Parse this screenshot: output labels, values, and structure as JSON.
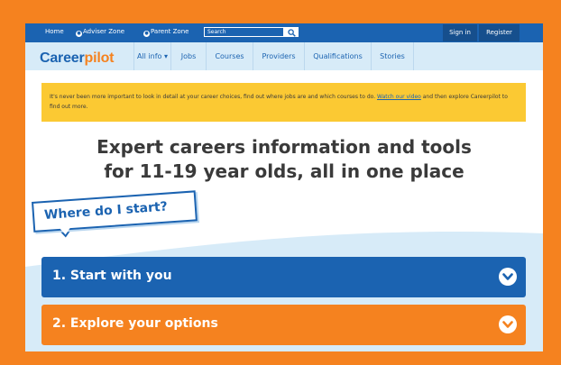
{
  "colors": {
    "frame": "#f5821f",
    "brand_blue": "#1b63b1",
    "brand_orange": "#f5821f",
    "nav_bg": "#d7ebf8",
    "notice_bg": "#fbc933"
  },
  "topbar": {
    "home": "Home",
    "adviser_zone": "Adviser Zone",
    "parent_zone": "Parent Zone",
    "search_placeholder": "Search",
    "search_icon": "search-icon",
    "sign_in": "Sign in",
    "register": "Register"
  },
  "nav": {
    "logo_career": "Career",
    "logo_pilot": "pilot",
    "items": [
      "All info ▾",
      "Jobs",
      "Courses",
      "Providers",
      "Qualifications",
      "Stories"
    ]
  },
  "notice": {
    "text_before": "It's never been more important to look in detail at your career choices, find out where jobs are and which courses to do. ",
    "link": "Watch our video",
    "text_after": " and then explore Careerpilot to find out more."
  },
  "hero": {
    "title_line1": "Expert careers information and tools",
    "title_line2": "for 11-19 year olds, all in one place"
  },
  "bubble": {
    "text": "Where do I start?"
  },
  "accordions": [
    {
      "label": "1. Start with you",
      "color": "#1b63b1",
      "icon": "chevron-down-icon"
    },
    {
      "label": "2. Explore your options",
      "color": "#f5821f",
      "icon": "chevron-down-icon"
    }
  ]
}
